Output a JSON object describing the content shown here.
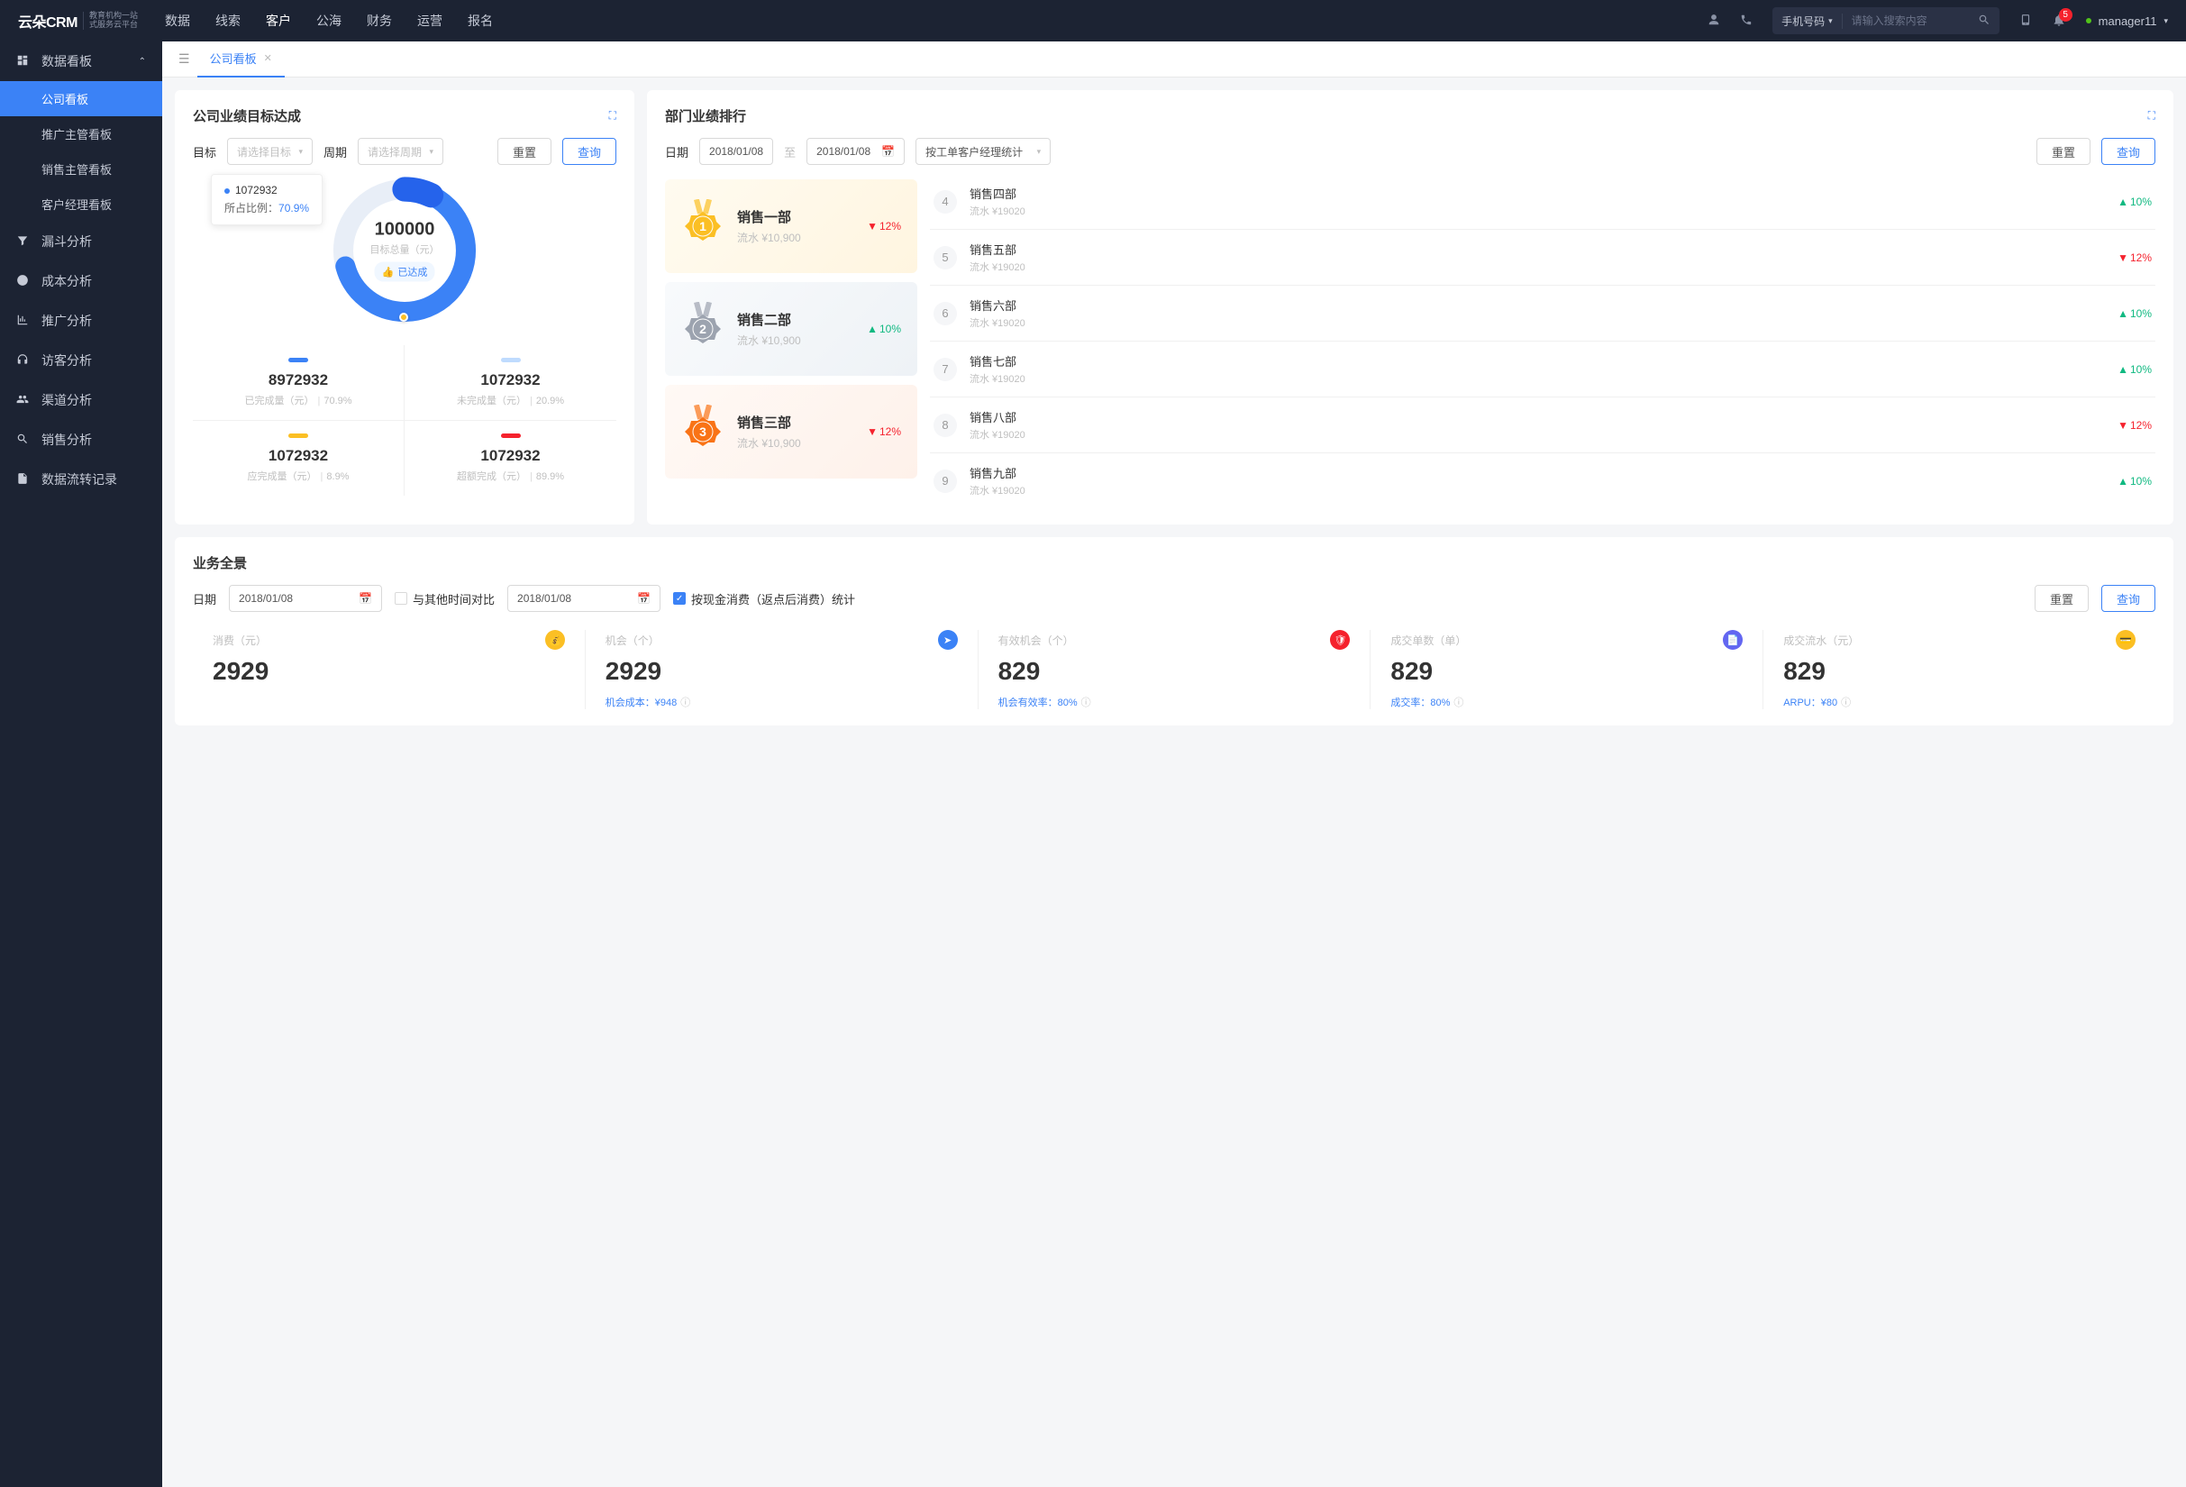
{
  "topnav": {
    "logo": "云朵CRM",
    "logo_sub1": "教育机构一站",
    "logo_sub2": "式服务云平台",
    "items": [
      "数据",
      "线索",
      "客户",
      "公海",
      "财务",
      "运营",
      "报名"
    ],
    "active_index": 2,
    "search_type": "手机号码",
    "search_placeholder": "请输入搜索内容",
    "notif_count": "5",
    "username": "manager11"
  },
  "sidebar": {
    "group_label": "数据看板",
    "subs": [
      "公司看板",
      "推广主管看板",
      "销售主管看板",
      "客户经理看板"
    ],
    "active_sub": 0,
    "items": [
      {
        "icon": "funnel",
        "label": "漏斗分析"
      },
      {
        "icon": "clock",
        "label": "成本分析"
      },
      {
        "icon": "chart",
        "label": "推广分析"
      },
      {
        "icon": "headset",
        "label": "访客分析"
      },
      {
        "icon": "group",
        "label": "渠道分析"
      },
      {
        "icon": "search",
        "label": "销售分析"
      },
      {
        "icon": "doc",
        "label": "数据流转记录"
      }
    ]
  },
  "tabs": {
    "current": "公司看板"
  },
  "goal_panel": {
    "title": "公司业绩目标达成",
    "target_label": "目标",
    "target_placeholder": "请选择目标",
    "period_label": "周期",
    "period_placeholder": "请选择周期",
    "reset": "重置",
    "query": "查询",
    "donut": {
      "total": "100000",
      "total_label": "目标总量（元）",
      "achieved_label": "已达成",
      "tooltip_val": "1072932",
      "tooltip_ratio_label": "所占比例：",
      "tooltip_pct": "70.9%"
    },
    "stats": [
      {
        "bar": "#3b82f6",
        "val": "8972932",
        "lbl": "已完成量（元）",
        "pct": "70.9%"
      },
      {
        "bar": "#bfdbfe",
        "val": "1072932",
        "lbl": "未完成量（元）",
        "pct": "20.9%"
      },
      {
        "bar": "#fbbf24",
        "val": "1072932",
        "lbl": "应完成量（元）",
        "pct": "8.9%"
      },
      {
        "bar": "#f5222d",
        "val": "1072932",
        "lbl": "超额完成（元）",
        "pct": "89.9%"
      }
    ]
  },
  "rank_panel": {
    "title": "部门业绩排行",
    "date_label": "日期",
    "date_from": "2018/01/08",
    "date_sep": "至",
    "date_to": "2018/01/08",
    "group_by": "按工单客户经理统计",
    "reset": "重置",
    "query": "查询",
    "top3": [
      {
        "rank": "1",
        "name": "销售一部",
        "flow": "流水 ¥10,900",
        "trend": "12%",
        "dir": "down",
        "cls": "gold",
        "color": "#fbbf24"
      },
      {
        "rank": "2",
        "name": "销售二部",
        "flow": "流水 ¥10,900",
        "trend": "10%",
        "dir": "up",
        "cls": "silver",
        "color": "#9ca3af"
      },
      {
        "rank": "3",
        "name": "销售三部",
        "flow": "流水 ¥10,900",
        "trend": "12%",
        "dir": "down",
        "cls": "bronze",
        "color": "#f97316"
      }
    ],
    "rest": [
      {
        "rank": "4",
        "name": "销售四部",
        "flow": "流水 ¥19020",
        "trend": "10%",
        "dir": "up"
      },
      {
        "rank": "5",
        "name": "销售五部",
        "flow": "流水 ¥19020",
        "trend": "12%",
        "dir": "down"
      },
      {
        "rank": "6",
        "name": "销售六部",
        "flow": "流水 ¥19020",
        "trend": "10%",
        "dir": "up"
      },
      {
        "rank": "7",
        "name": "销售七部",
        "flow": "流水 ¥19020",
        "trend": "10%",
        "dir": "up"
      },
      {
        "rank": "8",
        "name": "销售八部",
        "flow": "流水 ¥19020",
        "trend": "12%",
        "dir": "down"
      },
      {
        "rank": "9",
        "name": "销售九部",
        "flow": "流水 ¥19020",
        "trend": "10%",
        "dir": "up"
      }
    ]
  },
  "overview": {
    "title": "业务全景",
    "date_label": "日期",
    "date1": "2018/01/08",
    "compare_label": "与其他时间对比",
    "date2": "2018/01/08",
    "checkbox_label": "按现金消费（返点后消费）统计",
    "reset": "重置",
    "query": "查询",
    "metrics": [
      {
        "title": "消费（元）",
        "val": "2929",
        "sub": "",
        "icon_bg": "#fbbf24",
        "glyph": "bag"
      },
      {
        "title": "机会（个）",
        "val": "2929",
        "sub": "机会成本：¥948",
        "icon_bg": "#3b82f6",
        "glyph": "send"
      },
      {
        "title": "有效机会（个）",
        "val": "829",
        "sub": "机会有效率：80%",
        "icon_bg": "#f5222d",
        "glyph": "shield"
      },
      {
        "title": "成交单数（单）",
        "val": "829",
        "sub": "成交率：80%",
        "icon_bg": "#6366f1",
        "glyph": "doc"
      },
      {
        "title": "成交流水（元）",
        "val": "829",
        "sub": "ARPU：¥80",
        "icon_bg": "#fbbf24",
        "glyph": "card"
      }
    ]
  },
  "chart_data": {
    "type": "pie",
    "title": "公司业绩目标达成",
    "total_label": "目标总量（元）",
    "total": 100000,
    "series": [
      {
        "name": "已完成量（元）",
        "value": 8972932,
        "pct": 70.9,
        "color": "#3b82f6"
      },
      {
        "name": "未完成量（元）",
        "value": 1072932,
        "pct": 20.9,
        "color": "#bfdbfe"
      },
      {
        "name": "应完成量（元）",
        "value": 1072932,
        "pct": 8.9,
        "color": "#fbbf24"
      },
      {
        "name": "超额完成（元）",
        "value": 1072932,
        "pct": 89.9,
        "color": "#f5222d"
      }
    ],
    "highlighted_slice": {
      "value": 1072932,
      "pct": 70.9
    },
    "status": "已达成"
  }
}
